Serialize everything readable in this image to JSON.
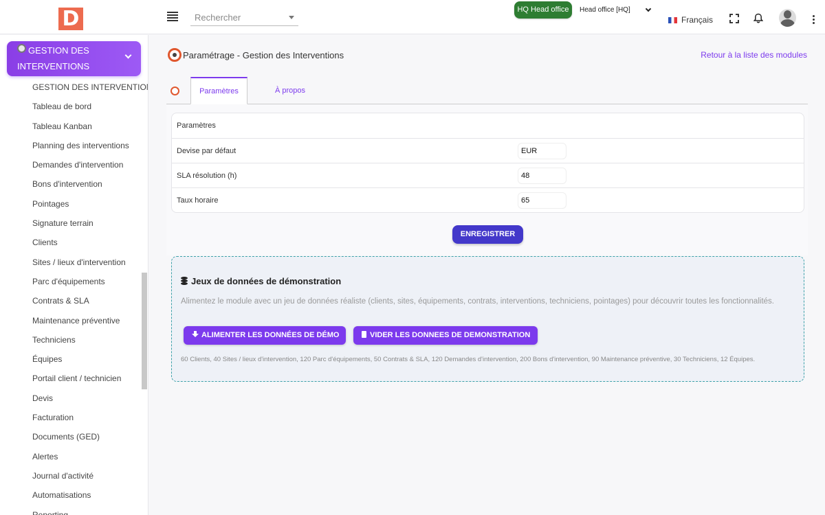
{
  "topbar": {
    "logo_letter": "D",
    "search_placeholder": "Rechercher",
    "entity_badge": "HQ Head office",
    "entity_select": "Head office [HQ]",
    "language": "Français"
  },
  "sidebar": {
    "module_title": "GESTION DES INTERVENTIONS",
    "items": [
      "GESTION DES INTERVENTIONS",
      "Tableau de bord",
      "Tableau Kanban",
      "Planning des interventions",
      "Demandes d'intervention",
      "Bons d'intervention",
      "Pointages",
      "Signature terrain",
      "Clients",
      "Sites / lieux d'intervention",
      "Parc d'équipements",
      "Contrats & SLA",
      "Maintenance préventive",
      "Techniciens",
      "Équipes",
      "Portail client / technicien",
      "Devis",
      "Facturation",
      "Documents (GED)",
      "Alertes",
      "Journal d'activité",
      "Automatisations",
      "Reporting"
    ]
  },
  "main": {
    "title": "Paramétrage - Gestion des Interventions",
    "back_link": "Retour à la liste des modules",
    "tabs": [
      {
        "label": "Paramètres"
      },
      {
        "label": "À propos"
      }
    ],
    "params": {
      "header": "Paramètres",
      "rows": [
        {
          "label": "Devise par défaut",
          "value": "EUR"
        },
        {
          "label": "SLA résolution (h)",
          "value": "48"
        },
        {
          "label": "Taux horaire",
          "value": "65"
        }
      ]
    },
    "save_label": "ENREGISTRER",
    "demo": {
      "title": "Jeux de données de démonstration",
      "description": "Alimentez le module avec un jeu de données réaliste (clients, sites, équipements, contrats, interventions, techniciens, pointages) pour découvrir toutes les fonctionnalités.",
      "fill_label": "ALIMENTER LES DONNÉES DE DÉMO",
      "clear_label": "VIDER LES DONNEES DE DEMONSTRATION",
      "stats": "60 Clients, 40 Sites / lieux d'intervention, 120 Parc d'équipements, 50 Contrats & SLA, 120 Demandes d'intervention, 200 Bons d'intervention, 90 Maintenance préventive, 30 Techniciens, 12 Équipes."
    }
  },
  "colors": {
    "accent": "#7c3aed",
    "save_button": "#4338ca",
    "badge": "#2e7d32",
    "logo": "#ed6b4f"
  }
}
